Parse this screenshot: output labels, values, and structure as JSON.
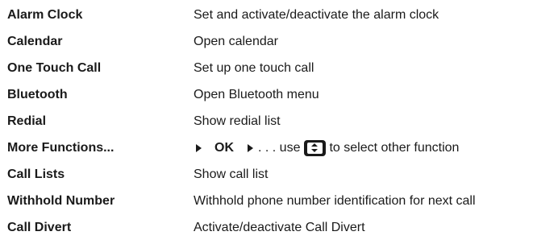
{
  "rows": [
    {
      "name": "Alarm Clock",
      "description": "Set and activate/deactivate the alarm clock"
    },
    {
      "name": "Calendar",
      "description": "Open calendar"
    },
    {
      "name": "One Touch Call",
      "description": "Set up one touch call"
    },
    {
      "name": "Bluetooth",
      "description": "Open Bluetooth menu"
    },
    {
      "name": "Redial",
      "description": "Show redial list"
    },
    {
      "name": "More Functions...",
      "description_parts": {
        "ok": "OK",
        "use": ". . . use",
        "rest": "to select other function"
      }
    },
    {
      "name": "Call Lists",
      "description": "Show call list"
    },
    {
      "name": "Withhold Number",
      "description": "Withhold phone number identification for next call"
    },
    {
      "name": "Call Divert",
      "description": "Activate/deactivate Call Divert"
    }
  ],
  "icons": {
    "arrow": "arrow-right-icon",
    "nav_key": "navigation-key-up-down-icon"
  }
}
